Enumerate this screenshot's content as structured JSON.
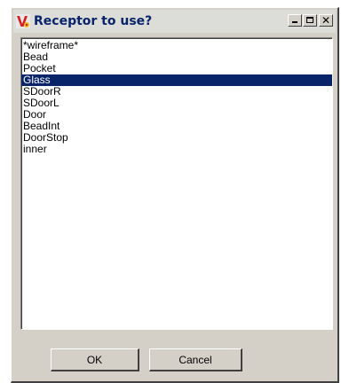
{
  "dialog": {
    "title": "Receptor to use?",
    "title_buttons": {
      "minimize": "minimize-icon",
      "maximize": "maximize-icon",
      "close": "close-icon"
    },
    "app_icon": "app-logo-icon"
  },
  "list": {
    "items": [
      {
        "label": "*wireframe*",
        "selected": false
      },
      {
        "label": "Bead",
        "selected": false
      },
      {
        "label": "Pocket",
        "selected": false
      },
      {
        "label": "Glass",
        "selected": true
      },
      {
        "label": "SDoorR",
        "selected": false
      },
      {
        "label": "SDoorL",
        "selected": false
      },
      {
        "label": "Door",
        "selected": false
      },
      {
        "label": "BeadInt",
        "selected": false
      },
      {
        "label": "DoorStop",
        "selected": false
      },
      {
        "label": "inner",
        "selected": false
      }
    ]
  },
  "buttons": {
    "ok_label": "OK",
    "cancel_label": "Cancel"
  },
  "colors": {
    "selection": "#0a246a",
    "title_text": "#0a246a",
    "face": "#d4d0c8"
  }
}
